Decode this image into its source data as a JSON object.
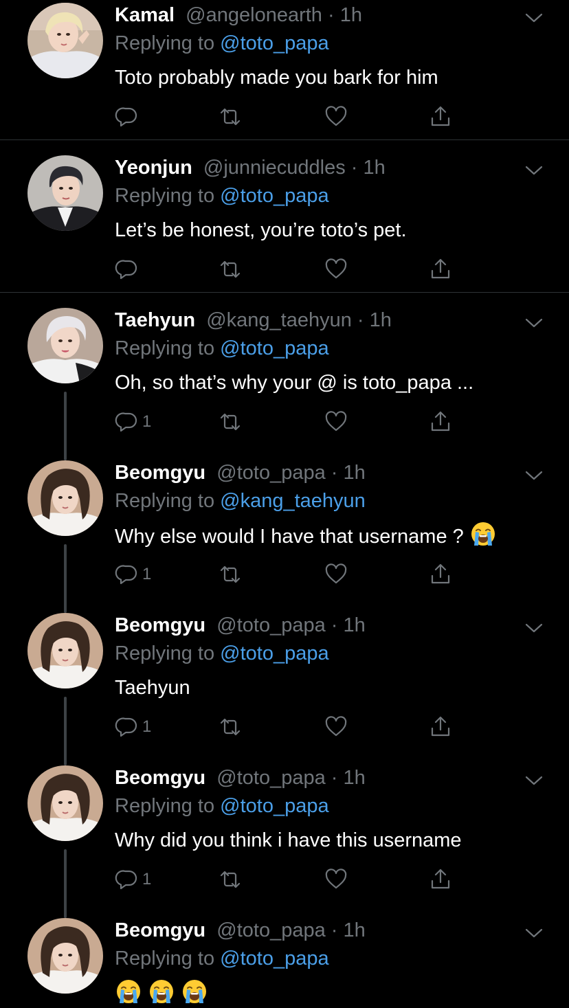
{
  "colors": {
    "background": "#000000",
    "name": "#ffffff",
    "meta": "#71767b",
    "mention": "#4b9fe8",
    "divider": "#2f3336"
  },
  "tweets": [
    {
      "name": "Kamal",
      "handle": "@angelonearth",
      "time": "1h",
      "replying_prefix": "Replying to ",
      "replying_to": "@toto_papa",
      "text": "Toto probably made you bark for him",
      "reply_count": "",
      "avatar": "avatar-blond",
      "thread": false,
      "divider": true
    },
    {
      "name": "Yeonjun",
      "handle": "@junniecuddles",
      "time": "1h",
      "replying_prefix": "Replying to ",
      "replying_to": "@toto_papa",
      "text": "Let’s be honest, you’re toto’s pet.",
      "reply_count": "",
      "avatar": "avatar-dark",
      "thread": false,
      "divider": true
    },
    {
      "name": "Taehyun",
      "handle": "@kang_taehyun",
      "time": "1h",
      "replying_prefix": "Replying to ",
      "replying_to": "@toto_papa",
      "text": "Oh, so that’s why your @ is toto_papa ...",
      "reply_count": "1",
      "avatar": "avatar-silver",
      "thread": true,
      "divider": false
    },
    {
      "name": "Beomgyu",
      "handle": "@toto_papa",
      "time": "1h",
      "replying_prefix": "Replying to ",
      "replying_to": "@kang_taehyun",
      "text": "Why else would I have that username ?",
      "emoji_count": 1,
      "reply_count": "1",
      "avatar": "avatar-brown",
      "thread": true,
      "divider": false
    },
    {
      "name": "Beomgyu",
      "handle": "@toto_papa",
      "time": "1h",
      "replying_prefix": "Replying to ",
      "replying_to": "@toto_papa",
      "text": "Taehyun",
      "reply_count": "1",
      "avatar": "avatar-brown",
      "thread": true,
      "divider": false
    },
    {
      "name": "Beomgyu",
      "handle": "@toto_papa",
      "time": "1h",
      "replying_prefix": "Replying to ",
      "replying_to": "@toto_papa",
      "text": "Why did you think i have this username",
      "reply_count": "1",
      "avatar": "avatar-brown",
      "thread": true,
      "divider": false
    },
    {
      "name": "Beomgyu",
      "handle": "@toto_papa",
      "time": "1h",
      "replying_prefix": "Replying to ",
      "replying_to": "@toto_papa",
      "text": "",
      "emoji_count": 3,
      "reply_count": "",
      "avatar": "avatar-brown",
      "thread": false,
      "divider": false
    }
  ],
  "icons": {
    "reply": "reply-icon",
    "retweet": "retweet-icon",
    "like": "heart-icon",
    "share": "share-icon",
    "more": "chevron-down-icon",
    "emoji": "loudly-crying-face-emoji"
  }
}
